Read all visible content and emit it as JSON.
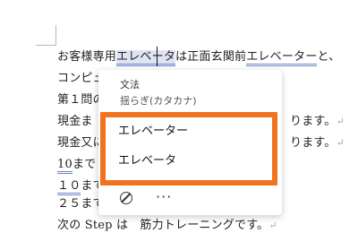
{
  "document": {
    "line1": {
      "pre": "お客様専用",
      "sel_a": "エレベ",
      "sel_b": "ータ",
      "mid": "は正面玄関前",
      "flag2": "エレベーター",
      "post": "と、"
    },
    "line2": "コンピュ",
    "line3": "第１問の",
    "line4": {
      "pre": "現金ま",
      "post": "ります。",
      "mark": "↵"
    },
    "line5": {
      "pre": "現金又に",
      "post": "ります。",
      "mark": "↵"
    },
    "line6": {
      "flag": "10",
      "pre": "まで"
    },
    "line7": {
      "flag": "１０",
      "pre": "まで"
    },
    "line8": {
      "pre": "２５まで"
    },
    "line9": {
      "pre": "次の Step は　筋力トレーニングです。",
      "mark": "↵"
    }
  },
  "popup": {
    "category": "文法",
    "issue": "揺らぎ(カタカナ)",
    "suggestions": [
      "エレベーター",
      "エレベータ"
    ],
    "more_label": "···"
  },
  "icons": {
    "ignore": "ignore-circle-slash-icon",
    "more": "more-horizontal-icon"
  },
  "colors": {
    "highlight": "#f2731f",
    "selection": "#dfe3f3",
    "grammar_underline": "#6f88c9"
  }
}
